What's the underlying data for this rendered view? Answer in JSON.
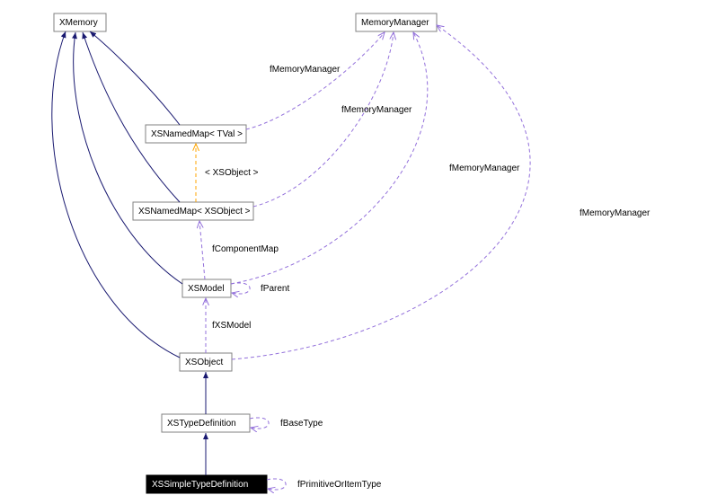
{
  "nodes": {
    "XMemory": "XMemory",
    "MemoryManager": "MemoryManager",
    "XSNamedMapTVal": "XSNamedMap< TVal >",
    "XSNamedMapXSObject": "XSNamedMap< XSObject >",
    "XSModel": "XSModel",
    "XSObjectNode": "XSObject",
    "XSTypeDefinition": "XSTypeDefinition",
    "XSSimpleTypeDefinition": "XSSimpleTypeDefinition"
  },
  "edgeLabels": {
    "fMemoryManager1": "fMemoryManager",
    "fMemoryManager2": "fMemoryManager",
    "fMemoryManager3": "fMemoryManager",
    "fMemoryManager4": "fMemoryManager",
    "templateArg": "< XSObject >",
    "fComponentMap": "fComponentMap",
    "fParent": "fParent",
    "fXSModel": "fXSModel",
    "fBaseType": "fBaseType",
    "fPrimitiveOrItemType": "fPrimitiveOrItemType"
  }
}
